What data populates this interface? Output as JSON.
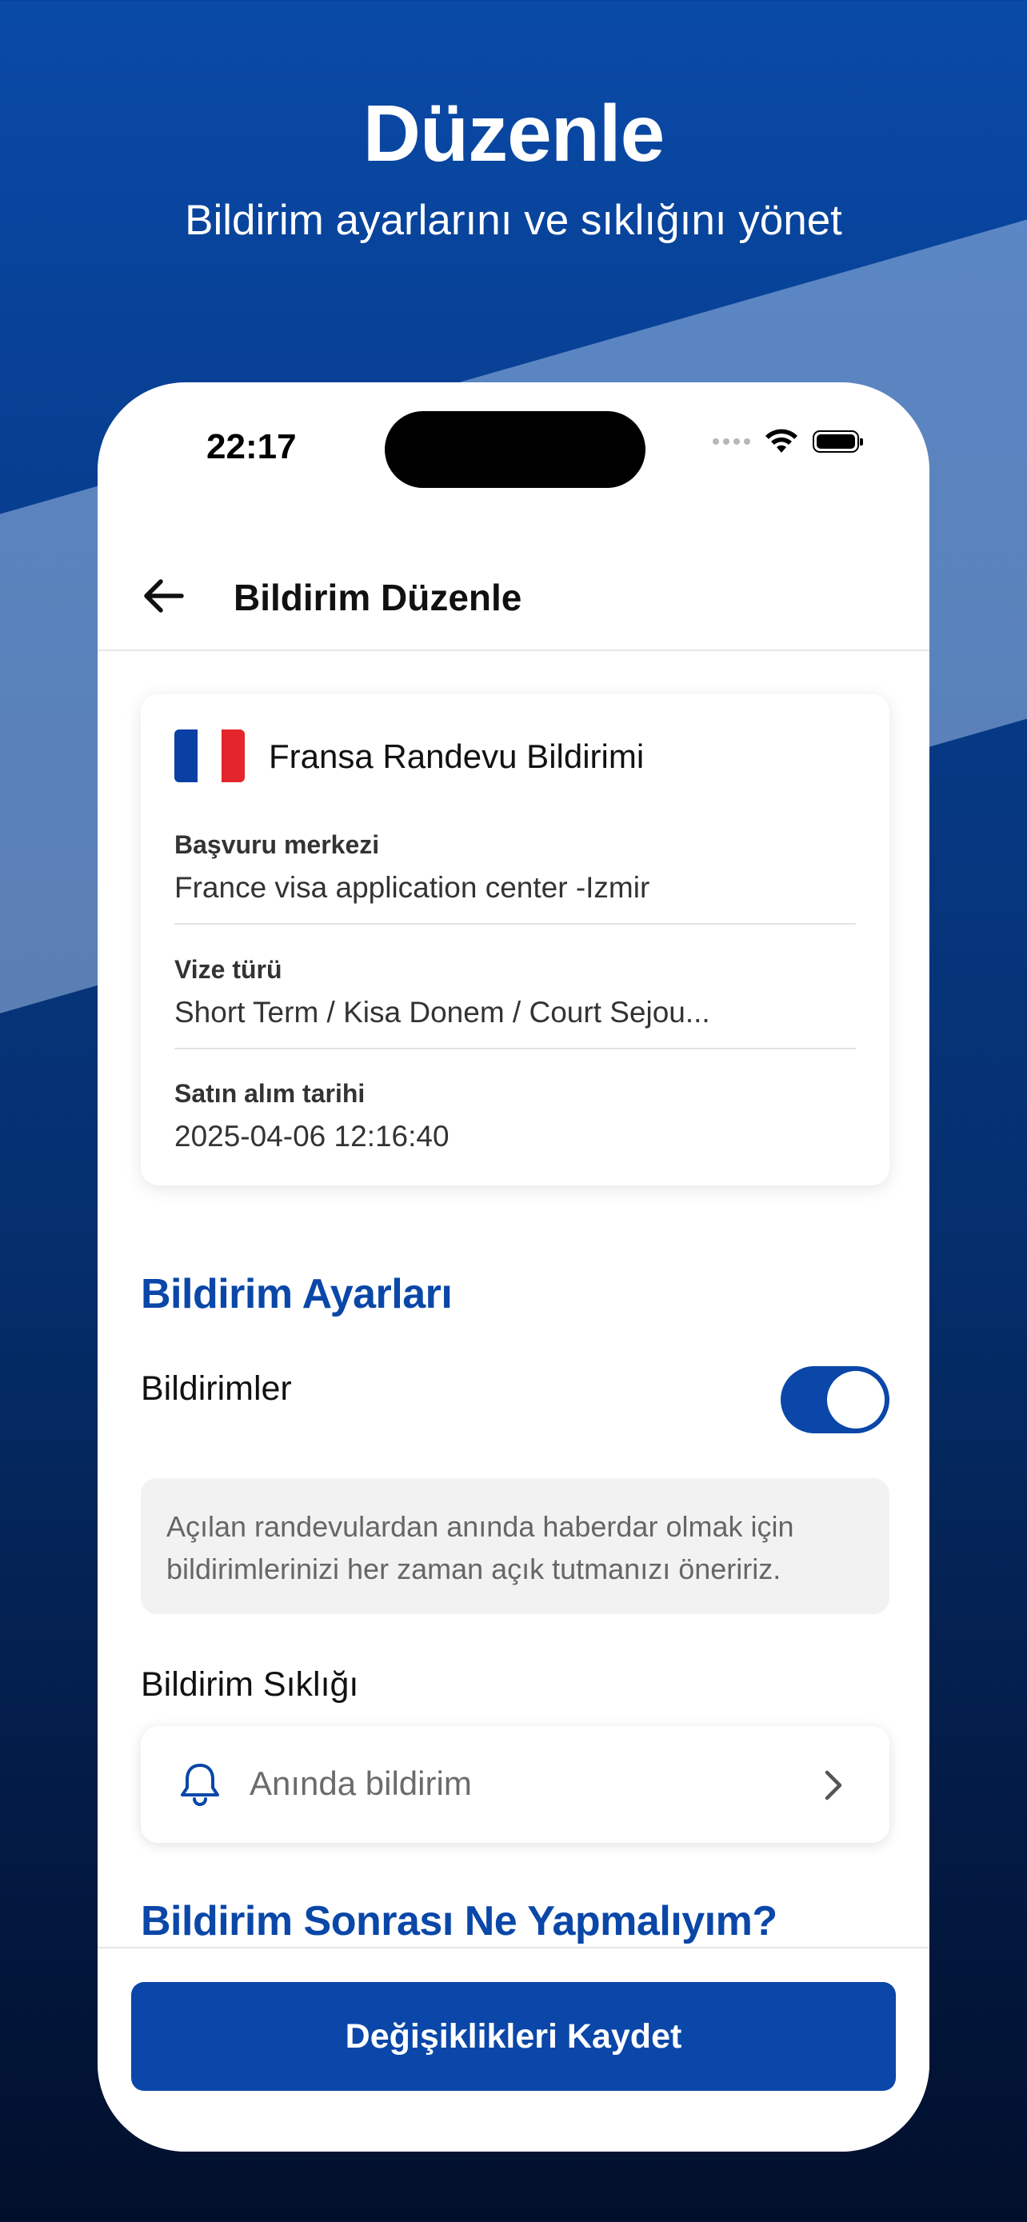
{
  "promo": {
    "title": "Düzenle",
    "subtitle": "Bildirim ayarlarını ve sıklığını yönet"
  },
  "status_bar": {
    "time": "22:17"
  },
  "nav": {
    "title": "Bildirim Düzenle"
  },
  "card": {
    "title": "Fransa Randevu Bildirimi",
    "flag_colors": [
      "#0a3fa3",
      "#ffffff",
      "#e3262b"
    ],
    "fields": [
      {
        "label": "Başvuru merkezi",
        "value": "France visa application center -Izmir"
      },
      {
        "label": "Vize türü",
        "value": "Short Term / Kisa Donem / Court Sejou..."
      },
      {
        "label": "Satın alım tarihi",
        "value": "2025-04-06 12:16:40"
      }
    ]
  },
  "settings": {
    "section_title": "Bildirim Ayarları",
    "notifications_label": "Bildirimler",
    "notifications_enabled": true,
    "info_text": "Açılan randevulardan anında haberdar olmak için bildirimlerinizi her zaman açık tutmanızı öneririz.",
    "frequency_label": "Bildirim Sıklığı",
    "frequency_value": "Anında bildirim"
  },
  "after_section": {
    "title": "Bildirim Sonrası Ne Yapmalıyım?"
  },
  "actions": {
    "save_label": "Değişiklikleri Kaydet"
  },
  "colors": {
    "accent": "#0a47a8",
    "background_top": "#0a4aa8",
    "background_bottom": "#020f2b"
  }
}
